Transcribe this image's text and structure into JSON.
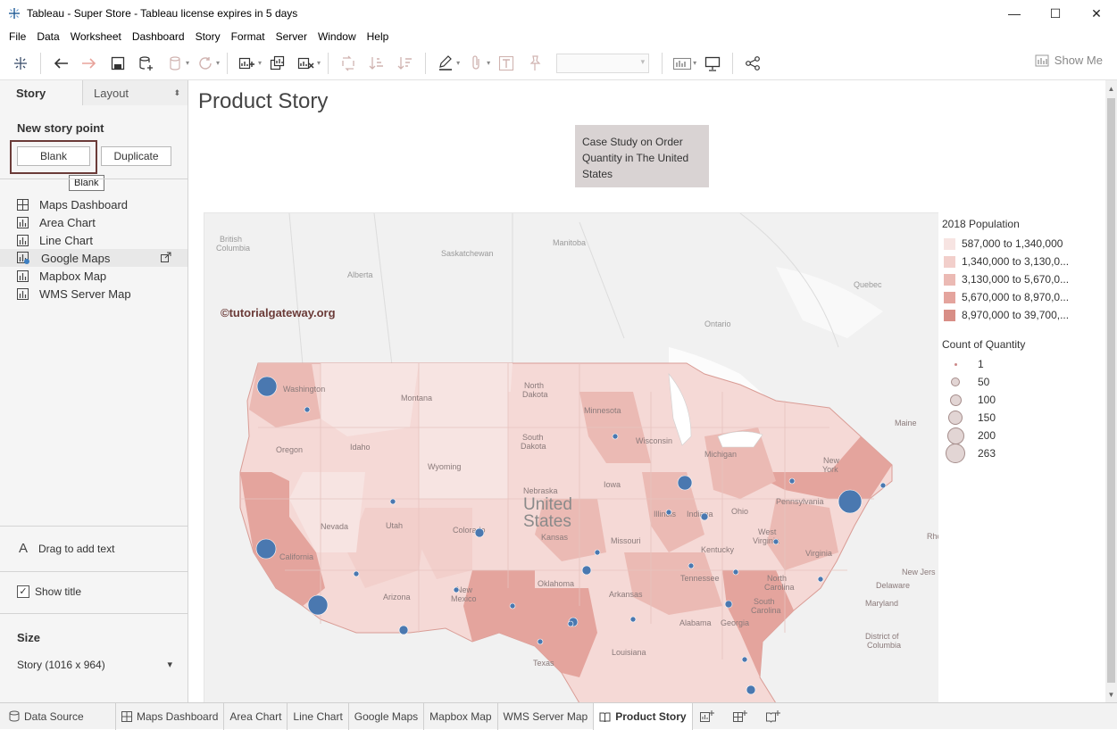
{
  "window": {
    "title": "Tableau - Super Store - Tableau license expires in 5 days",
    "controls": [
      "—",
      "☐",
      "✕"
    ]
  },
  "menu": [
    "File",
    "Data",
    "Worksheet",
    "Dashboard",
    "Story",
    "Format",
    "Server",
    "Window",
    "Help"
  ],
  "toolbar": {
    "show_me": "Show Me"
  },
  "left_panel": {
    "tabs": {
      "story": "Story",
      "layout": "Layout"
    },
    "new_story_point": "New story point",
    "blank_button": "Blank",
    "duplicate_button": "Duplicate",
    "tooltip": "Blank",
    "sheets": [
      {
        "label": "Maps Dashboard",
        "icon": "dashboard-icon"
      },
      {
        "label": "Area Chart",
        "icon": "worksheet-icon"
      },
      {
        "label": "Line Chart",
        "icon": "worksheet-icon"
      },
      {
        "label": "Google Maps",
        "icon": "worksheet-icon"
      },
      {
        "label": "Mapbox Map",
        "icon": "worksheet-icon"
      },
      {
        "label": "WMS Server Map",
        "icon": "worksheet-icon"
      }
    ],
    "drag_text": "Drag to add text",
    "drag_text_icon": "A",
    "show_title": "Show title",
    "show_title_checked": true,
    "size_heading": "Size",
    "size_value": "Story (1016 x 964)"
  },
  "story": {
    "title": "Product Story",
    "caption": "Case Study on Order Quantity in The United States",
    "watermark": "©tutorialgateway.org"
  },
  "map_labels": {
    "british_columbia": "British\nColumbia",
    "alberta": "Alberta",
    "saskatchewan": "Saskatchewan",
    "manitoba": "Manitoba",
    "quebec": "Quebec",
    "ontario": "Ontario",
    "washington": "Washington",
    "montana": "Montana",
    "north_dakota": "North\nDakota",
    "minnesota": "Minnesota",
    "south_dakota": "South\nDakota",
    "wisconsin": "Wisconsin",
    "michigan": "Michigan",
    "new_york": "New\nYork",
    "maine": "Maine",
    "oregon": "Oregon",
    "idaho": "Idaho",
    "wyoming": "Wyoming",
    "nebraska": "Nebraska",
    "united_states": "United\nStates",
    "iowa": "Iowa",
    "pennsylvania": "Pennsylvania",
    "nevada": "Nevada",
    "utah": "Utah",
    "colorado": "Colorado",
    "kansas": "Kansas",
    "missouri": "Missouri",
    "illinois": "Illinois",
    "indiana": "Indiana",
    "ohio": "Ohio",
    "west_virginia": "West\nVirginia",
    "california": "California",
    "kentucky": "Kentucky",
    "virginia": "Virginia",
    "oklahoma": "Oklahoma",
    "tennessee": "Tennessee",
    "north_carolina": "North\nCarolina",
    "arizona": "Arizona",
    "new_mexico": "New\nMexico",
    "arkansas": "Arkansas",
    "south_carolina": "South\nCarolina",
    "alabama": "Alabama",
    "georgia": "Georgia",
    "texas": "Texas",
    "louisiana": "Louisiana",
    "new_jersey": "New Jers",
    "delaware": "Delaware",
    "maryland": "Maryland",
    "district_of_columbia": "District of\nColumbia",
    "rhode_island": "Rhc"
  },
  "legend_population": {
    "title": "2018 Population",
    "items": [
      {
        "label": "587,000 to 1,340,000",
        "color": "#f7e4e2"
      },
      {
        "label": "1,340,000 to 3,130,0...",
        "color": "#f2cfcb"
      },
      {
        "label": "3,130,000 to 5,670,0...",
        "color": "#ebbab4"
      },
      {
        "label": "5,670,000 to 8,970,0...",
        "color": "#e4a49d"
      },
      {
        "label": "8,970,000 to 39,700,...",
        "color": "#d88e86"
      }
    ]
  },
  "legend_quantity": {
    "title": "Count of Quantity",
    "items": [
      {
        "label": "1",
        "value": 1
      },
      {
        "label": "50",
        "value": 50
      },
      {
        "label": "100",
        "value": 100
      },
      {
        "label": "150",
        "value": 150
      },
      {
        "label": "200",
        "value": 200
      },
      {
        "label": "263",
        "value": 263
      }
    ]
  },
  "bottom_tabs": {
    "data_source": "Data Source",
    "tabs": [
      "Maps Dashboard",
      "Area Chart",
      "Line Chart",
      "Google Maps",
      "Mapbox Map",
      "WMS Server Map"
    ],
    "active": "Product Story"
  },
  "colors": {
    "accent_marks": "#4a78b0",
    "blank_frame": "#6b3b38",
    "caption_bg": "#d9d3d3"
  }
}
